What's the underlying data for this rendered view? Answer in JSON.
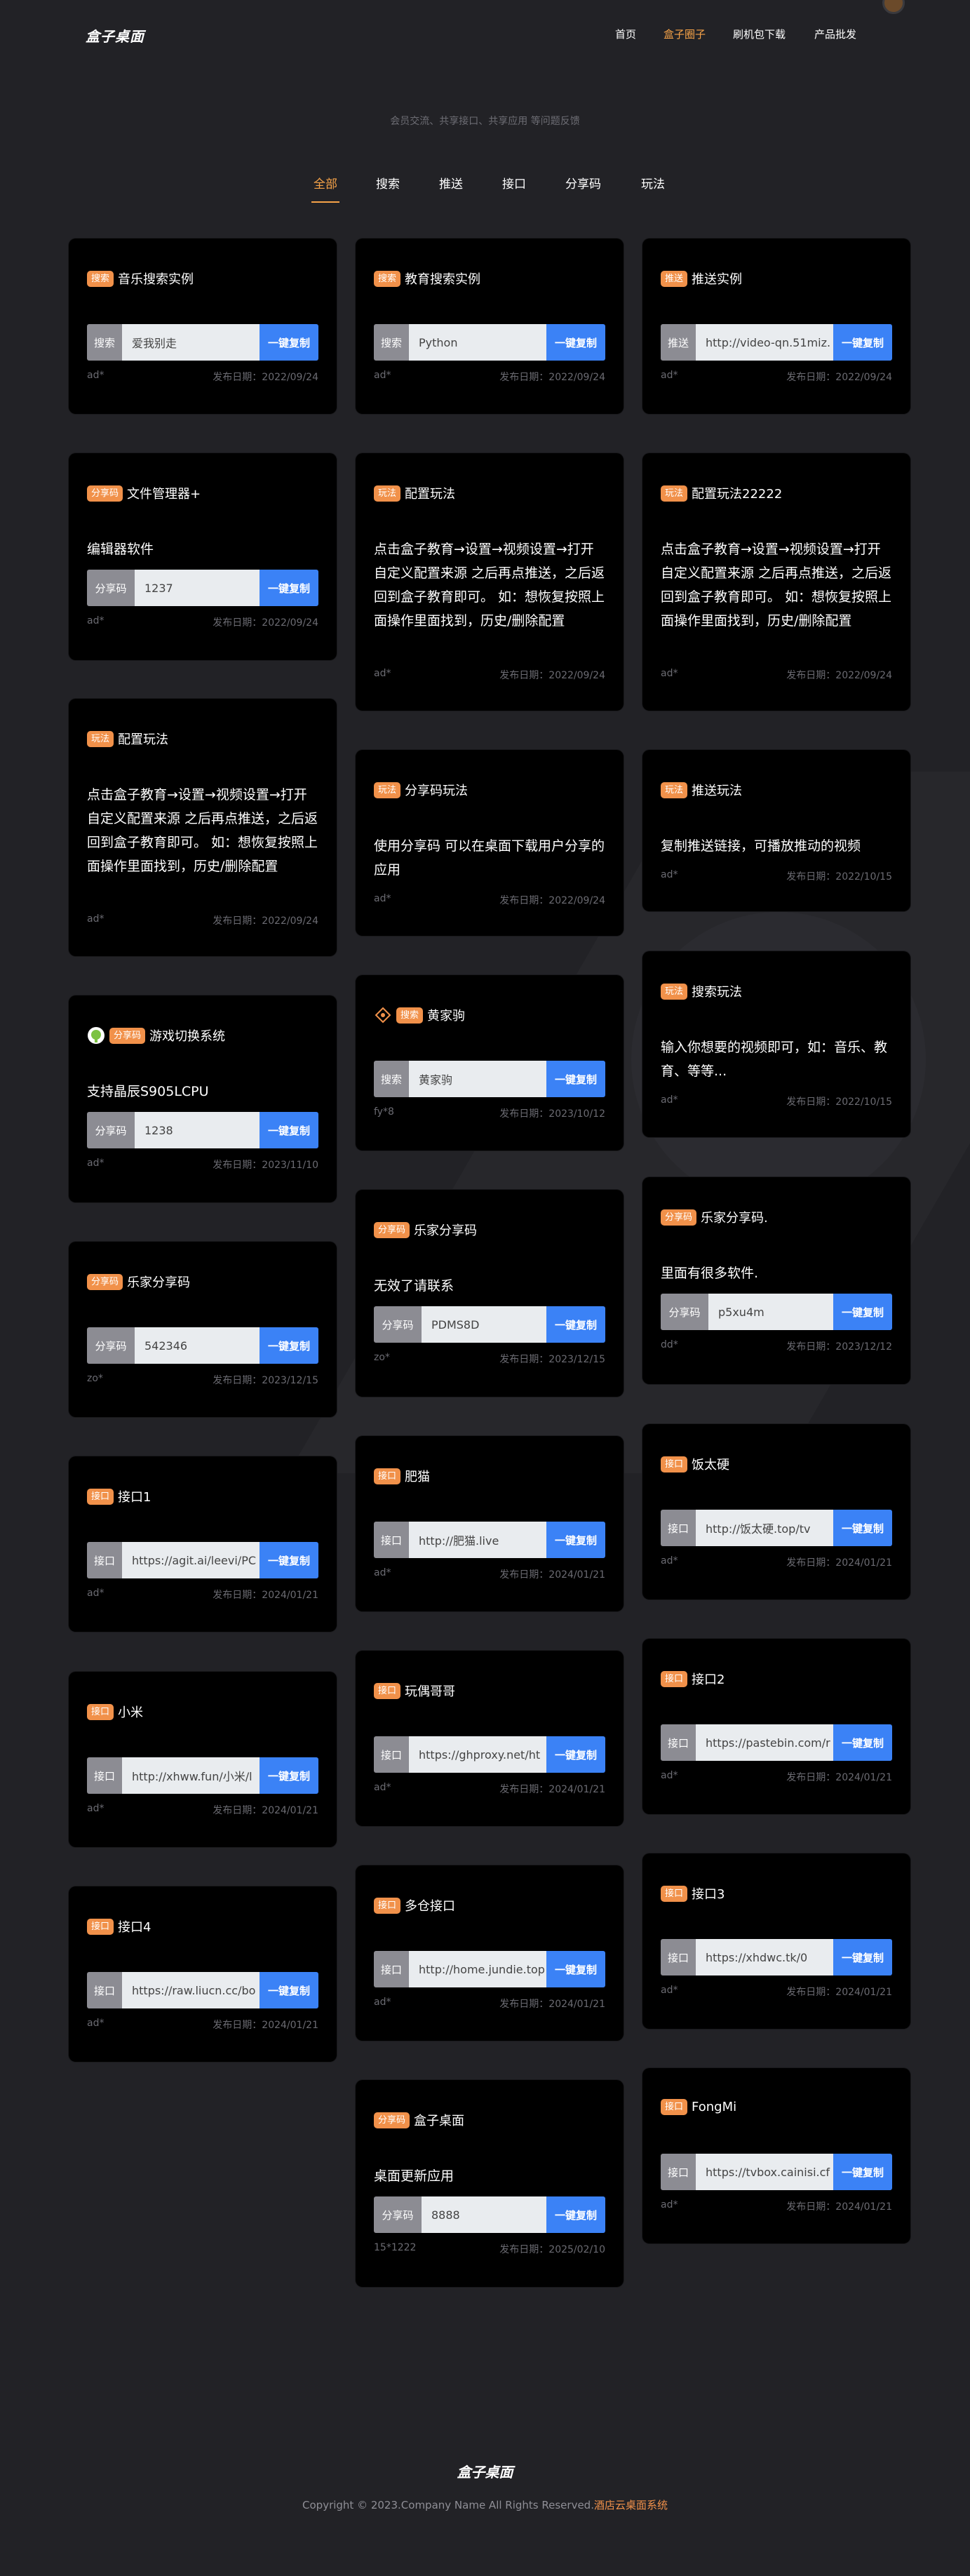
{
  "header": {
    "logo": "盒子桌面",
    "nav": [
      {
        "label": "首页",
        "active": false
      },
      {
        "label": "盒子圈子",
        "active": true
      },
      {
        "label": "刷机包下载",
        "active": false
      },
      {
        "label": "产品批发",
        "active": false
      }
    ]
  },
  "subtitle": "会员交流、共享接口、共享应用 等问题反馈",
  "tabs": [
    {
      "label": "全部",
      "active": true
    },
    {
      "label": "搜索"
    },
    {
      "label": "推送"
    },
    {
      "label": "接口"
    },
    {
      "label": "分享码"
    },
    {
      "label": "玩法"
    }
  ],
  "copy_button_label": "一键复制",
  "date_prefix": "发布日期：",
  "cards": [
    {
      "badge": "搜索",
      "title": "音乐搜索实例",
      "label": "搜索",
      "value": "爱我别走",
      "author": "ad*",
      "date": "2022/09/24"
    },
    {
      "badge": "分享码",
      "title": "文件管理器+",
      "desc": "编辑器软件",
      "label": "分享码",
      "value": "1237",
      "author": "ad*",
      "date": "2022/09/24"
    },
    {
      "badge": "玩法",
      "title": "配置玩法",
      "desc": "点击盒子教育→设置→视频设置→打开自定义配置来源 之后再点推送，之后返回到盒子教育即可。 如：想恢复按照上面操作里面找到，历史/删除配置",
      "author": "ad*",
      "date": "2022/09/24"
    },
    {
      "badge": "分享码",
      "title": "游戏切换系统",
      "desc": "支持晶辰S905LCPU",
      "label": "分享码",
      "value": "1238",
      "author": "ad*",
      "date": "2023/11/10"
    },
    {
      "badge": "分享码",
      "title": "乐家分享码",
      "label": "分享码",
      "value": "542346",
      "author": "zo*",
      "date": "2023/12/15"
    },
    {
      "badge": "接口",
      "title": "接口1",
      "label": "接口",
      "value": "https://agit.ai/leevi/PC",
      "author": "ad*",
      "date": "2024/01/21"
    },
    {
      "badge": "接口",
      "title": "小米",
      "label": "接口",
      "value": "http://xhww.fun/小米/l",
      "author": "ad*",
      "date": "2024/01/21"
    },
    {
      "badge": "接口",
      "title": "接口4",
      "label": "接口",
      "value": "https://raw.liucn.cc/bo",
      "author": "ad*",
      "date": "2024/01/21"
    },
    {
      "badge": "搜索",
      "title": "教育搜索实例",
      "label": "搜索",
      "value": "Python",
      "author": "ad*",
      "date": "2022/09/24"
    },
    {
      "badge": "玩法",
      "title": "配置玩法",
      "desc": "点击盒子教育→设置→视频设置→打开自定义配置来源 之后再点推送，之后返回到盒子教育即可。 如：想恢复按照上面操作里面找到，历史/删除配置",
      "author": "ad*",
      "date": "2022/09/24"
    },
    {
      "badge": "玩法",
      "title": "分享码玩法",
      "desc": "使用分享码 可以在桌面下载用户分享的应用",
      "author": "ad*",
      "date": "2022/09/24"
    },
    {
      "badge": "搜索",
      "title": "黄家驹",
      "label": "搜索",
      "value": "黄家驹",
      "author": "fy*8",
      "date": "2023/10/12"
    },
    {
      "badge": "分享码",
      "title": "乐家分享码",
      "desc": "无效了请联系",
      "label": "分享码",
      "value": "PDMS8D",
      "author": "zo*",
      "date": "2023/12/15"
    },
    {
      "badge": "接口",
      "title": "肥猫",
      "label": "接口",
      "value": "http://肥猫.live",
      "author": "ad*",
      "date": "2024/01/21"
    },
    {
      "badge": "接口",
      "title": "玩偶哥哥",
      "label": "接口",
      "value": "https://ghproxy.net/ht",
      "author": "ad*",
      "date": "2024/01/21"
    },
    {
      "badge": "接口",
      "title": "多仓接口",
      "label": "接口",
      "value": "http://home.jundie.top",
      "author": "ad*",
      "date": "2024/01/21"
    },
    {
      "badge": "分享码",
      "title": "盒子桌面",
      "desc": "桌面更新应用",
      "label": "分享码",
      "value": "8888",
      "author": "15*1222",
      "date": "2025/02/10"
    },
    {
      "badge": "推送",
      "title": "推送实例",
      "label": "推送",
      "value": "http://video-qn.51miz.",
      "author": "ad*",
      "date": "2022/09/24"
    },
    {
      "badge": "玩法",
      "title": "配置玩法22222",
      "desc": "点击盒子教育→设置→视频设置→打开自定义配置来源 之后再点推送，之后返回到盒子教育即可。 如：想恢复按照上面操作里面找到，历史/删除配置",
      "author": "ad*",
      "date": "2022/09/24"
    },
    {
      "badge": "玩法",
      "title": "推送玩法",
      "desc": "复制推送链接，可播放推动的视频",
      "author": "ad*",
      "date": "2022/10/15"
    },
    {
      "badge": "玩法",
      "title": "搜索玩法",
      "desc": "输入你想要的视频即可，如：音乐、教育、等等...",
      "author": "ad*",
      "date": "2022/10/15"
    },
    {
      "badge": "分享码",
      "title": "乐家分享码.",
      "desc": "里面有很多软件.",
      "label": "分享码",
      "value": "p5xu4m",
      "author": "dd*",
      "date": "2023/12/12"
    },
    {
      "badge": "接口",
      "title": "饭太硬",
      "label": "接口",
      "value": "http://饭太硬.top/tv",
      "author": "ad*",
      "date": "2024/01/21"
    },
    {
      "badge": "接口",
      "title": "接口2",
      "label": "接口",
      "value": "https://pastebin.com/r",
      "author": "ad*",
      "date": "2024/01/21"
    },
    {
      "badge": "接口",
      "title": "接口3",
      "label": "接口",
      "value": "https://xhdwc.tk/0",
      "author": "ad*",
      "date": "2024/01/21"
    },
    {
      "badge": "接口",
      "title": "FongMi",
      "label": "接口",
      "value": "https://tvbox.cainisi.cf",
      "author": "ad*",
      "date": "2024/01/21"
    }
  ],
  "footer": {
    "logo": "盒子桌面",
    "copyright": "Copyright © 2023.Company Name All Rights Reserved.",
    "link": "酒店云桌面系统"
  }
}
